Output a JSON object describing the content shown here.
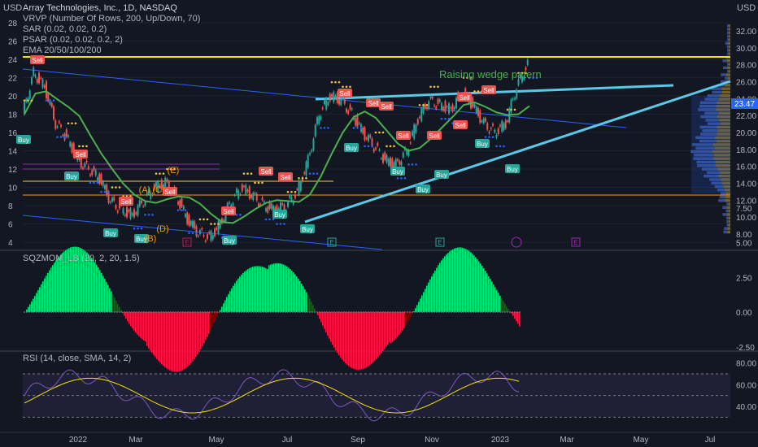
{
  "chart_data": {
    "type": "line",
    "symbol": "Array Technologies, Inc., 1D, NASDAQ",
    "currency": "USD",
    "last_price": "23.47",
    "indicators": [
      "VRVP (Number Of Rows, 200, Up/Down, 70)",
      "SAR (0.02, 0.02, 0.2)",
      "PSAR (0.02, 0.02, 0.2, 2)",
      "EMA 20/50/100/200"
    ],
    "annotation": "Raising wedge patern",
    "left_ticks": [
      "28",
      "26",
      "24",
      "22",
      "20",
      "18",
      "16",
      "14",
      "12",
      "10",
      "8",
      "6",
      "4"
    ],
    "right_ticks": [
      "32.00",
      "30.00",
      "28.00",
      "26.00",
      "24.00",
      "22.00",
      "20.00",
      "18.00",
      "16.00",
      "14.00",
      "12.00",
      "10.00",
      "8.00"
    ],
    "x_ticks": [
      "2022",
      "Mar",
      "May",
      "Jul",
      "Sep",
      "Nov",
      "2023",
      "Mar",
      "May",
      "Jul"
    ],
    "price_series": {
      "x_index": [
        0,
        6,
        12,
        18,
        24,
        30,
        36,
        42,
        48,
        54,
        60,
        66,
        72,
        78,
        84,
        90,
        96,
        102,
        108,
        114,
        120,
        126,
        132,
        138,
        144,
        150,
        156,
        162,
        168,
        174,
        180,
        186,
        192,
        198,
        204,
        210,
        216,
        222,
        228,
        234,
        240,
        246,
        252,
        258,
        264,
        270,
        276
      ],
      "close": [
        18,
        22.5,
        21,
        17,
        15.5,
        13,
        12,
        11,
        8.5,
        7.5,
        7,
        8.5,
        10,
        10.5,
        9,
        6.5,
        5,
        4.5,
        6,
        8.5,
        10,
        9,
        8,
        7.5,
        8,
        9.5,
        13,
        18,
        20,
        19.5,
        18,
        16,
        14.5,
        13,
        12.5,
        14,
        17.5,
        19.5,
        19,
        18.5,
        20.5,
        19,
        17,
        16,
        17,
        21,
        23.47
      ]
    },
    "labels": {
      "sell": [
        "Sell",
        "Sell",
        "Sell",
        "Sell",
        "Sell",
        "Sell",
        "Sell",
        "Sell",
        "Sell",
        "Sell",
        "Sell",
        "Sell",
        "Sell",
        "Sell",
        "Sell"
      ],
      "buy": [
        "Buy",
        "Buy",
        "Buy",
        "Buy",
        "Buy",
        "Buy",
        "Buy",
        "Buy",
        "Buy",
        "Buy",
        "Buy",
        "Buy",
        "Buy"
      ],
      "elliott": [
        "(A)",
        "(C)",
        "(E)",
        "(B)",
        "(D)"
      ],
      "earnings": "E"
    },
    "sqzmom": {
      "title": "SQZMOM_LB (20, 2, 20, 1.5)",
      "ticks": [
        "7.50",
        "5.00",
        "2.50",
        "0.00",
        "-2.50"
      ],
      "ylim": [
        -4,
        7.5
      ]
    },
    "rsi": {
      "title": "RSI (14, close, SMA, 14, 2)",
      "ticks": [
        "80.00",
        "60.00",
        "40.00"
      ],
      "upper_band": 70,
      "lower_band": 30,
      "ylim": [
        25,
        85
      ]
    }
  },
  "colors": {
    "background": "#131722",
    "up": "#26a69a",
    "down": "#ef5350",
    "wedge": "#5ac8e6",
    "yellow_line": "#f5e600",
    "ema_green": "#4caf50",
    "sar_dots": "#f5c542",
    "psar_blue": "#2962ff",
    "rsi_line": "#7e57c2",
    "rsi_ma": "#f5e600",
    "annotation": "#4caf50"
  }
}
